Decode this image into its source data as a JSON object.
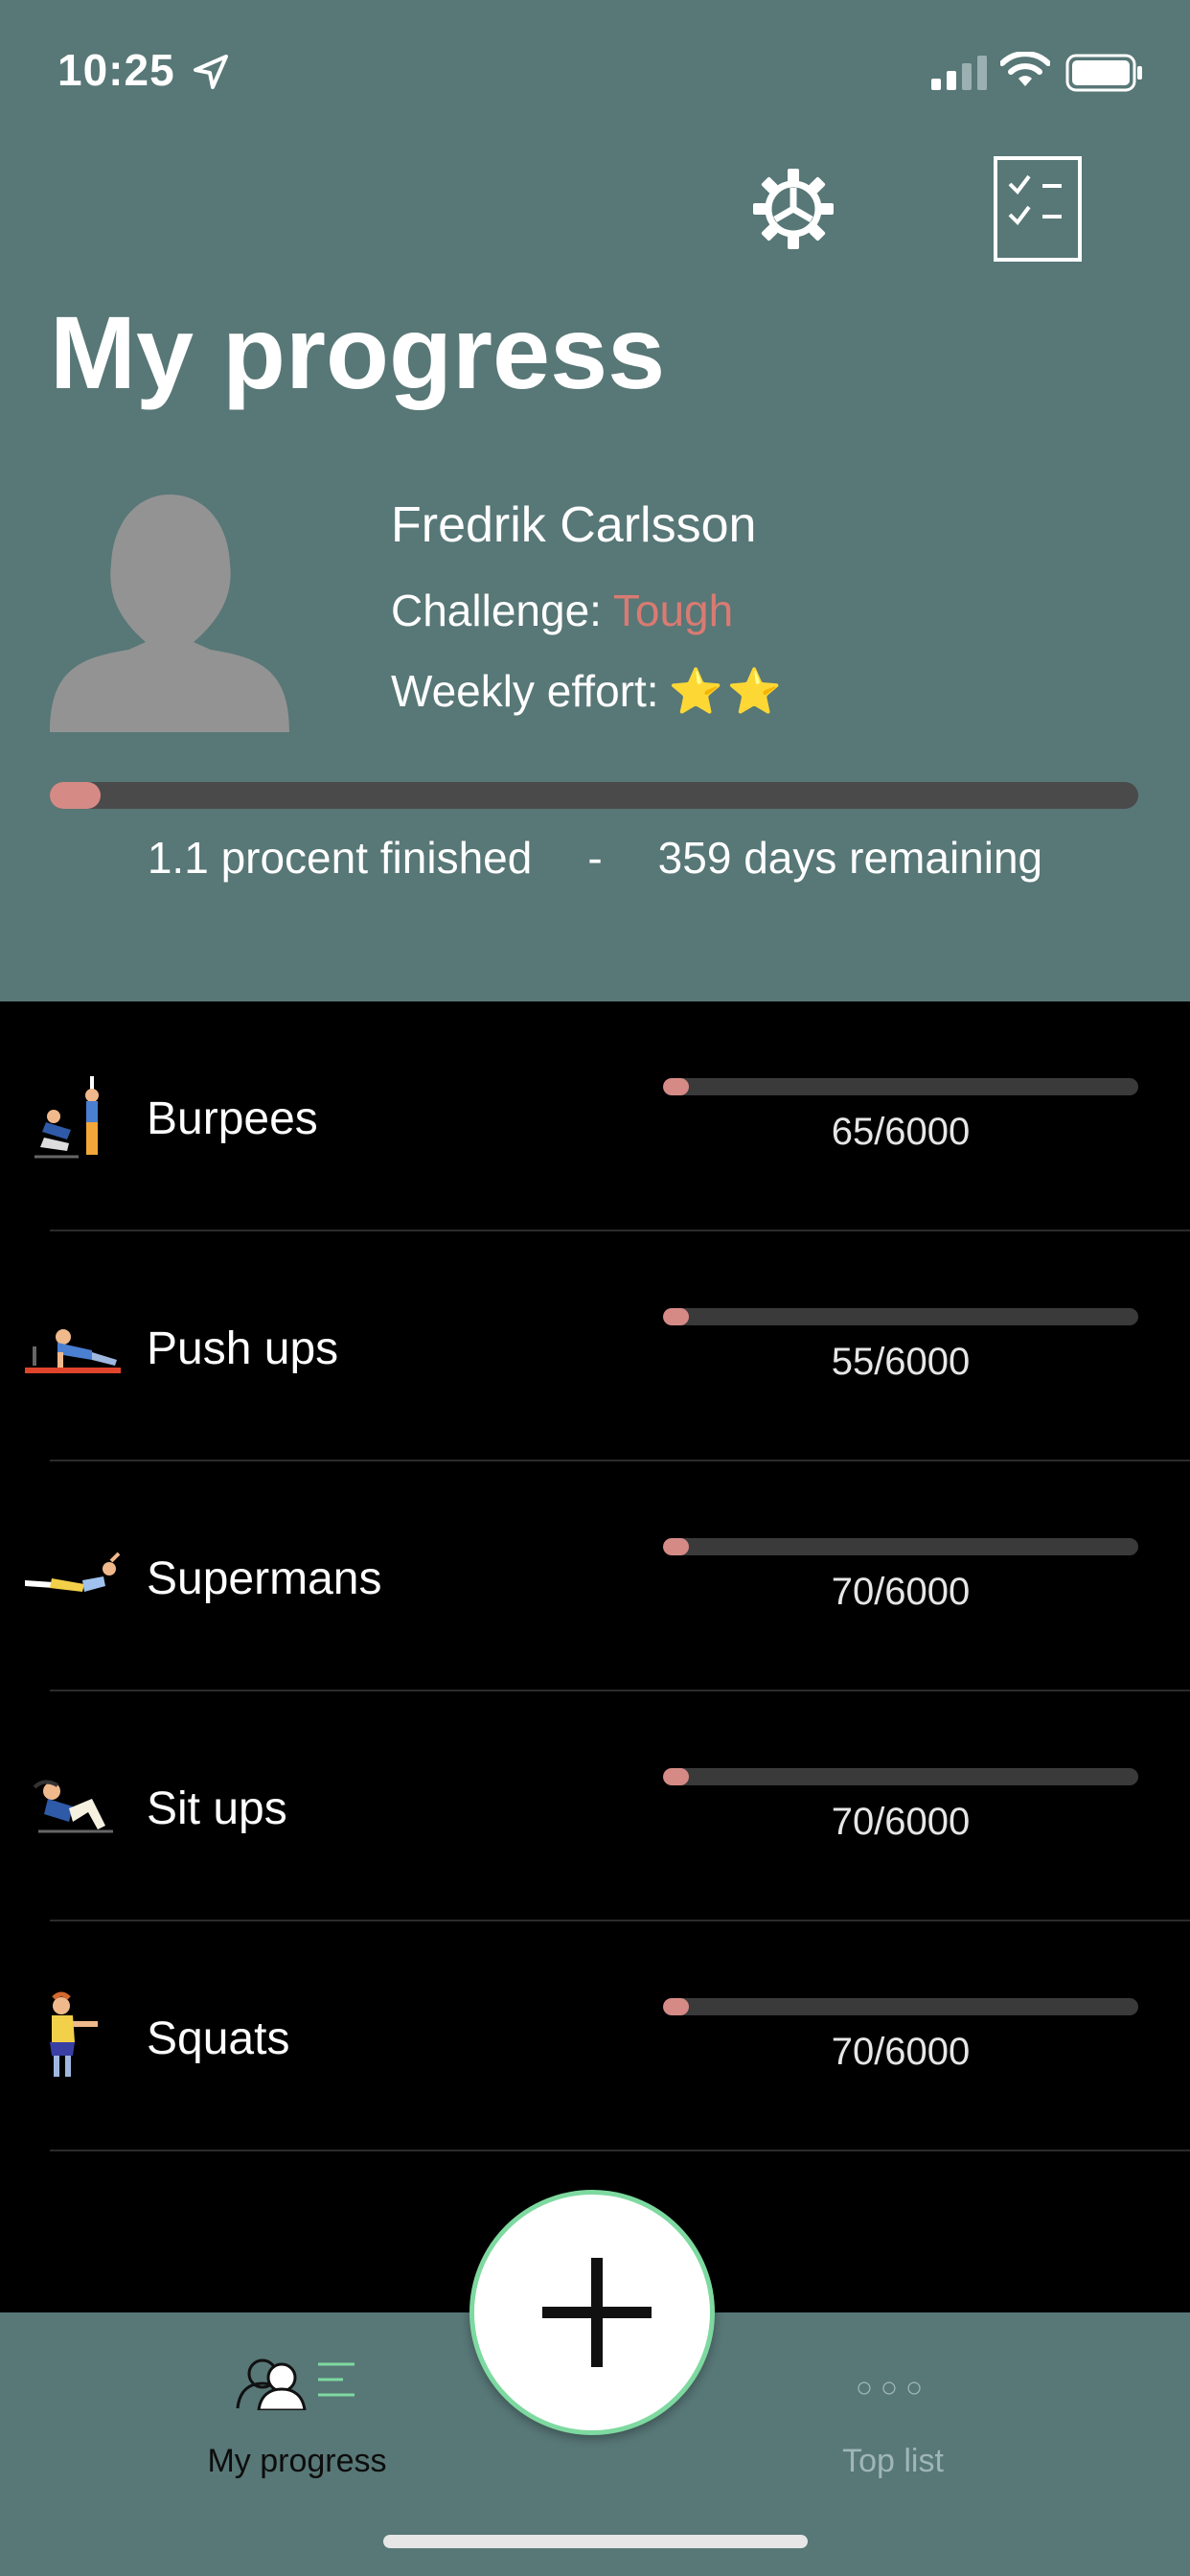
{
  "status_bar": {
    "time": "10:25"
  },
  "header": {
    "title": "My progress",
    "user_name": "Fredrik Carlsson",
    "challenge_label": "Challenge:",
    "challenge_value": "Tough",
    "effort_label": "Weekly effort:",
    "effort_stars": "⭐⭐",
    "overall_progress_fraction": 0.011,
    "percent_text": "1.1 procent finished",
    "separator": "-",
    "days_text": "359 days remaining"
  },
  "exercises": [
    {
      "label": "Burpees",
      "count": "65/6000",
      "progress": 0.0108,
      "icon": "burpees-icon"
    },
    {
      "label": "Push ups",
      "count": "55/6000",
      "progress": 0.0092,
      "icon": "push-ups-icon"
    },
    {
      "label": "Supermans",
      "count": "70/6000",
      "progress": 0.0117,
      "icon": "supermans-icon"
    },
    {
      "label": "Sit ups",
      "count": "70/6000",
      "progress": 0.0117,
      "icon": "sit-ups-icon"
    },
    {
      "label": "Squats",
      "count": "70/6000",
      "progress": 0.0117,
      "icon": "squats-icon"
    }
  ],
  "tabbar": {
    "progress_label": "My progress",
    "toplist_label": "Top list",
    "toplist_dots": "○○○"
  },
  "colors": {
    "header_bg": "#587777",
    "accent": "#d68a86",
    "challenge_value": "#d97b72",
    "add_button_ring": "#7ed9a0"
  }
}
